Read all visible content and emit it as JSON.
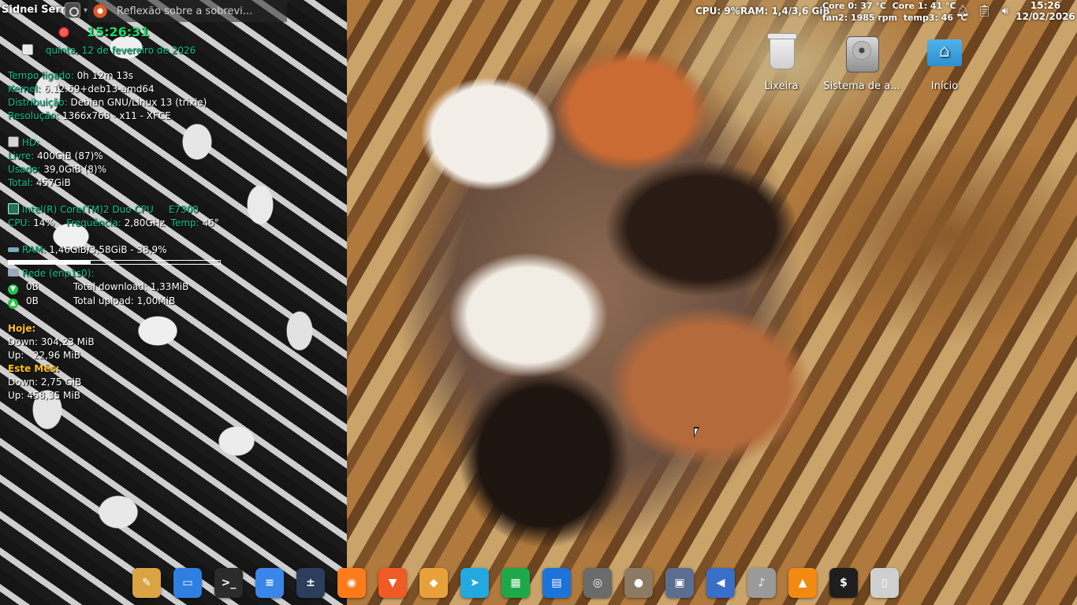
{
  "panel": {
    "user": "Sidnei Serra",
    "active_window_title": "Reflexão sobre a sobrevi...",
    "cpu": "CPU: 9%",
    "ram": "RAM: 1,4/3,6 GiB",
    "sensors_line1": "Core 0: 37 °C  Core 1: 41 °C",
    "sensors_line2": "fan2: 1985 rpm  temp3: 46 °C",
    "clock_time": "15:26",
    "clock_date": "12/02/2026",
    "tray_icons": [
      "bell-icon",
      "clipboard-icon",
      "volume-icon"
    ]
  },
  "conky": {
    "time": "15:26:31",
    "date": "quinta, 12 de fevereiro de 2026",
    "uptime_label": "Tempo ligado:",
    "uptime_value": "0h 12m 13s",
    "kernel_label": "Kernel:",
    "kernel_value": "6.12.69+deb13-amd64",
    "distro_label": "Distribuição:",
    "distro_value": "Debian GNU/Linux 13 (trixie)",
    "resolution_label": "Resolução:",
    "resolution_value": "1366x768 - x11 - XFCE",
    "hd_title": "HD:",
    "hd_free_label": "Livre:",
    "hd_free_value": "400GiB (87)%",
    "hd_used_label": "Usado:",
    "hd_used_value": "39,0GiB (8)%",
    "hd_total_label": "Total:",
    "hd_total_value": "457GiB",
    "cpu_model": "Intel(R) Core(TM)2 Duo CPU     E7300",
    "cpu_label": "CPU:",
    "cpu_value": "14%",
    "freq_label": "Frequência:",
    "freq_value": "2,80GHz",
    "temp_label": "Temp:",
    "temp_value": "46°",
    "ram_label": "RAM:",
    "ram_value": "1,46GiB/3,58GiB - 38,9%",
    "ram_fraction": 0.389,
    "net_title": "Rede (enp1s0):",
    "down_speed": "0B",
    "down_total": "Total download: 1,33MiB",
    "up_speed": "0B",
    "up_total": "Total upload: 1,00MiB",
    "today_title": "Hoje:",
    "today_down": "Down: 304,23 MiB",
    "today_up": "Up:   22,96 MiB",
    "month_title": "Este Mês:",
    "month_down": "Down: 2,75 GiB",
    "month_up": "Up: 458,35 MiB"
  },
  "desktop_icons": [
    {
      "label": "Lixeira",
      "icon": "trash-icon"
    },
    {
      "label": "Sistema de a...",
      "icon": "hard-drive-icon"
    },
    {
      "label": "Início",
      "icon": "home-folder-icon"
    }
  ],
  "dock": [
    {
      "icon": "brush-icon",
      "color": "#d9a441"
    },
    {
      "icon": "file-manager-icon",
      "color": "#2f7fe0"
    },
    {
      "icon": "terminal-icon",
      "color": "#2b2b2b"
    },
    {
      "icon": "settings-icon",
      "color": "#3a86e8"
    },
    {
      "icon": "calculator-icon",
      "color": "#2c3e5c"
    },
    {
      "icon": "firefox-icon",
      "color": "#ff7a1a"
    },
    {
      "icon": "brave-icon",
      "color": "#f05a24"
    },
    {
      "icon": "archive-icon",
      "color": "#e8a13a"
    },
    {
      "icon": "bird-icon",
      "color": "#24a8e0"
    },
    {
      "icon": "spreadsheet-icon",
      "color": "#1fa84a"
    },
    {
      "icon": "writer-icon",
      "color": "#1c73d8"
    },
    {
      "icon": "screenshot-icon",
      "color": "#6b6b6b"
    },
    {
      "icon": "gimp-icon",
      "color": "#8c7b63"
    },
    {
      "icon": "scanner-icon",
      "color": "#5b6e8f"
    },
    {
      "icon": "audio-icon",
      "color": "#3a6fc9"
    },
    {
      "icon": "volume-icon",
      "color": "#9a9a9a"
    },
    {
      "icon": "vlc-icon",
      "color": "#f28a12"
    },
    {
      "icon": "shell-icon",
      "color": "#1e1e1e"
    },
    {
      "icon": "trash-icon",
      "color": "#cfcfcf"
    }
  ]
}
